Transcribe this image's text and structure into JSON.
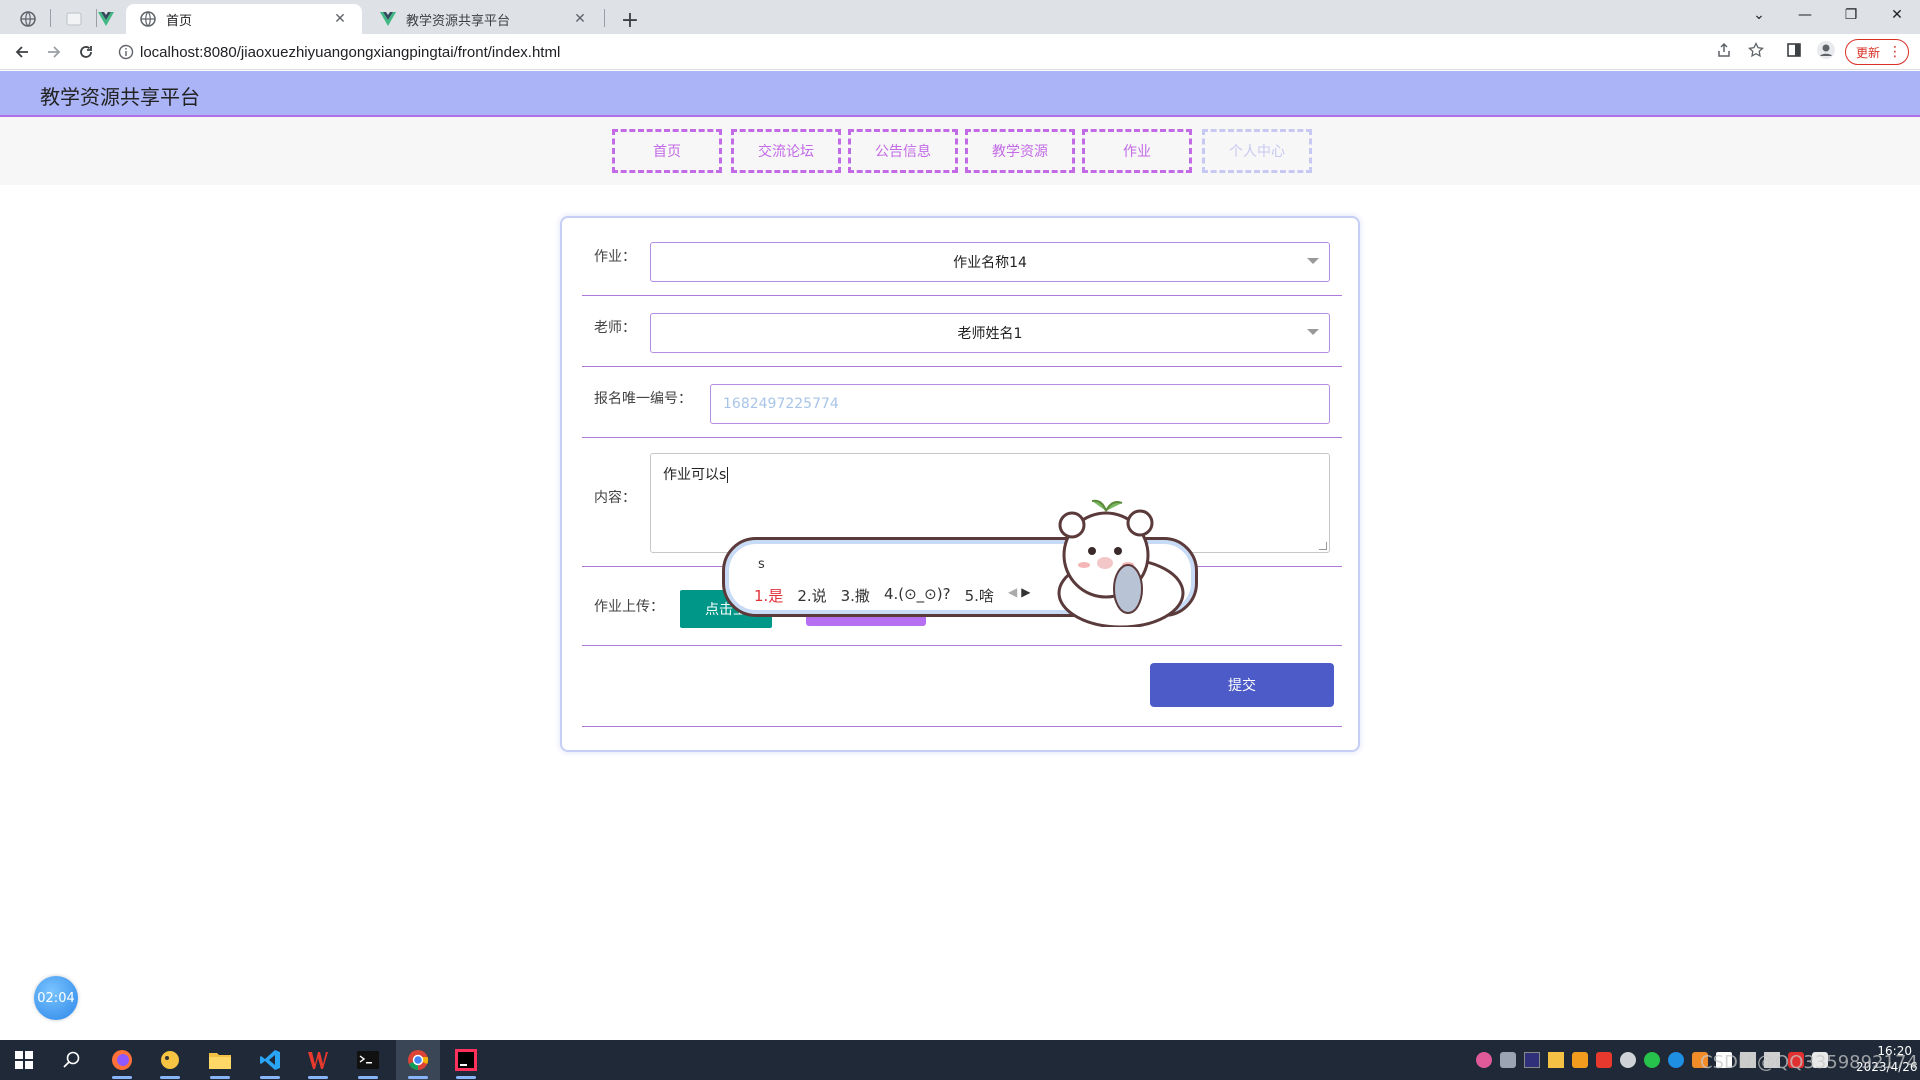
{
  "browser": {
    "tabs": [
      {
        "title": "首页",
        "active": true
      },
      {
        "title": "教学资源共享平台",
        "active": false
      }
    ],
    "url": "localhost:8080/jiaoxuezhiyuangongxiangpingtai/front/index.html",
    "update_label": "更新",
    "accent": "#d93025"
  },
  "site": {
    "title": "教学资源共享平台",
    "header_color": "#aab4f7",
    "nav": [
      {
        "label": "首页"
      },
      {
        "label": "交流论坛"
      },
      {
        "label": "公告信息"
      },
      {
        "label": "教学资源"
      },
      {
        "label": "作业"
      },
      {
        "label": "个人中心"
      }
    ]
  },
  "form": {
    "homework_label": "作业：",
    "homework_value": "作业名称14",
    "teacher_label": "老师：",
    "teacher_value": "老师姓名1",
    "signup_label": "报名唯一编号：",
    "signup_value": "1682497225774",
    "content_label": "内容：",
    "content_value": "作业可以s",
    "upload_label": "作业上传：",
    "upload_button": "点击上",
    "submit_label": "提交"
  },
  "ime": {
    "preedit": "s",
    "candidates": [
      "1.是",
      "2.说",
      "3.撒",
      "4.(⊙_⊙)?",
      "5.啥"
    ]
  },
  "timer": {
    "value": "02:04"
  },
  "taskbar": {
    "clock_time": "16:20",
    "clock_date": "2023/4/26",
    "watermark": "CSDN @QQ3359892174"
  }
}
